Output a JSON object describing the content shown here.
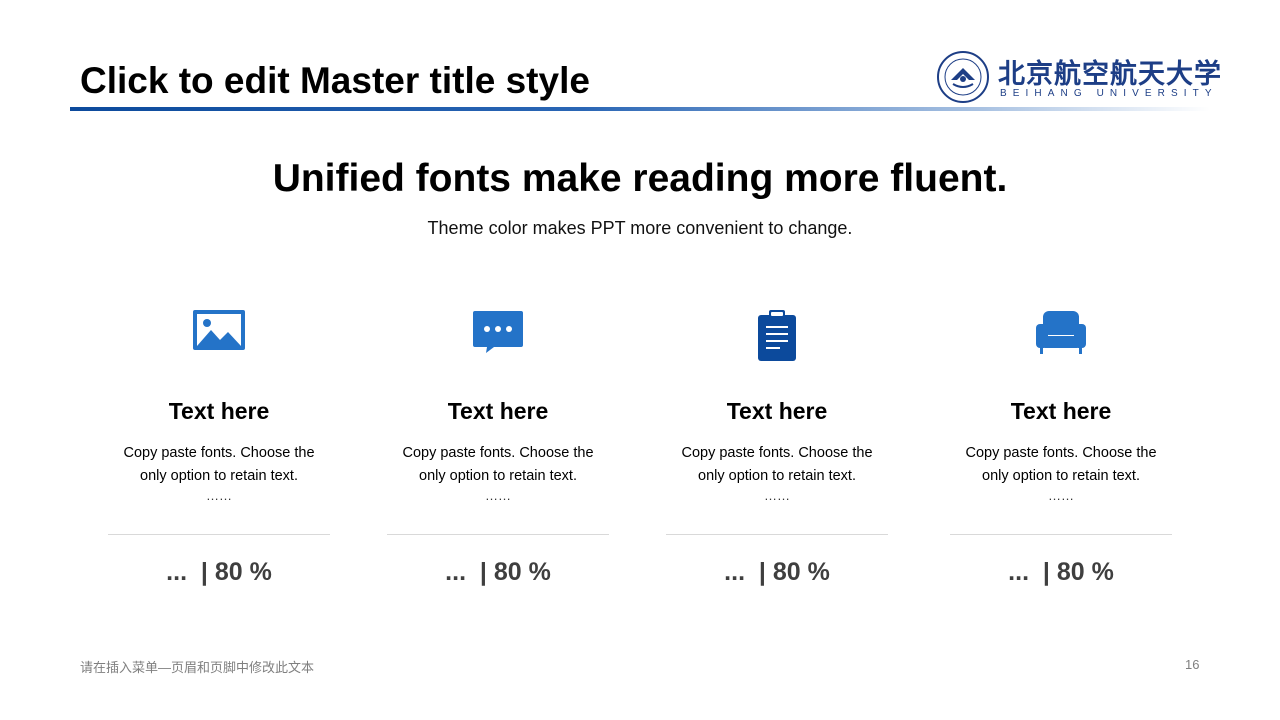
{
  "header": {
    "title": "Click to edit Master title style",
    "logo": {
      "cn": "北京航空航天大学",
      "en": "BEIHANG UNIVERSITY"
    }
  },
  "main": {
    "heading": "Unified fonts make reading more fluent.",
    "subheading": "Theme color makes PPT more convenient to change.",
    "cards": [
      {
        "icon": "image-icon",
        "title": "Text here",
        "desc": "Copy paste fonts. Choose the\nonly option to retain text.",
        "ellipsis": "……",
        "stat": "...  | 80 %"
      },
      {
        "icon": "chat-bubble-icon",
        "title": "Text here",
        "desc": "Copy paste fonts. Choose the\nonly option to retain text.",
        "ellipsis": "……",
        "stat": "...  | 80 %"
      },
      {
        "icon": "clipboard-icon",
        "title": "Text here",
        "desc": "Copy paste fonts. Choose the\nonly option to retain text.",
        "ellipsis": "……",
        "stat": "...  | 80 %"
      },
      {
        "icon": "sofa-icon",
        "title": "Text here",
        "desc": "Copy paste fonts. Choose the\nonly option to retain text.",
        "ellipsis": "……",
        "stat": "...  | 80 %"
      }
    ]
  },
  "footer": {
    "note": "请在插入菜单—页眉和页脚中修改此文本",
    "page_number": "16"
  },
  "colors": {
    "brand_dark": "#0c4a9c",
    "icon_blue": "#2473c8",
    "logo_navy": "#1d3e86",
    "stat_gray": "#3f3f3f"
  }
}
